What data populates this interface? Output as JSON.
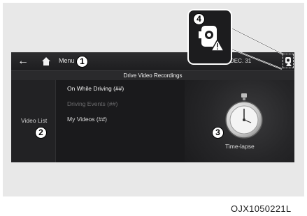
{
  "topbar": {
    "menu_label": "Menu",
    "date_label": "DEC. 31"
  },
  "subtitle": "Drive Video Recordings",
  "sidebar": {
    "video_list_label": "Video List"
  },
  "menu_items": [
    {
      "label": "On While Driving (##)",
      "state": "active"
    },
    {
      "label": "Driving Events (##)",
      "state": "disabled"
    },
    {
      "label": "My Videos (##)",
      "state": "normal"
    }
  ],
  "timelapse": {
    "label": "Time-lapse"
  },
  "callouts": [
    "1",
    "2",
    "3",
    "4"
  ],
  "icons": {
    "back": "back-arrow-icon",
    "home": "home-icon",
    "settings": "dashcam-settings-icon",
    "stopwatch": "stopwatch-icon",
    "warning": "warning-triangle-icon"
  },
  "colors": {
    "screen_bg": "#1a1a1c",
    "panel_bg": "#e8e8e8",
    "text_primary": "#f2f2f2",
    "text_disabled": "#6d6d6f"
  },
  "figure_code": "OJX1050221L"
}
